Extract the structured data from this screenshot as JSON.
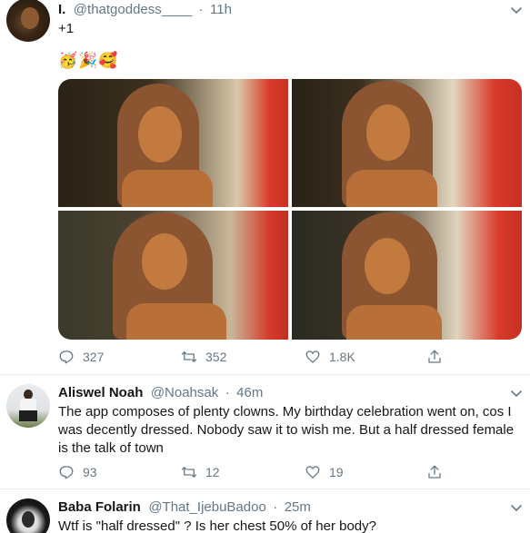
{
  "tweet1": {
    "display_name": "I.",
    "handle": "@thatgoddess____",
    "separator": "·",
    "time": "11h",
    "text": "+1",
    "emojis": "🥳🎉🥰",
    "replies": "327",
    "retweets": "352",
    "likes": "1.8K"
  },
  "tweet2": {
    "display_name": "Aliswel Noah",
    "handle": "@Noahsak",
    "separator": "·",
    "time": "46m",
    "text": "The app composes of plenty clowns. My birthday celebration went on, cos I was decently dressed. Nobody saw it to wish me. But a half dressed female is the talk of town",
    "replies": "93",
    "retweets": "12",
    "likes": "19"
  },
  "tweet3": {
    "display_name": "Baba Folarin",
    "handle": "@That_IjebuBadoo",
    "separator": "·",
    "time": "25m",
    "text": "Wtf is \"half dressed\" ? Is her chest 50% of her body?"
  },
  "colors": {
    "text_primary": "#14171a",
    "text_secondary": "#657786",
    "divider": "#e6ecf0"
  }
}
